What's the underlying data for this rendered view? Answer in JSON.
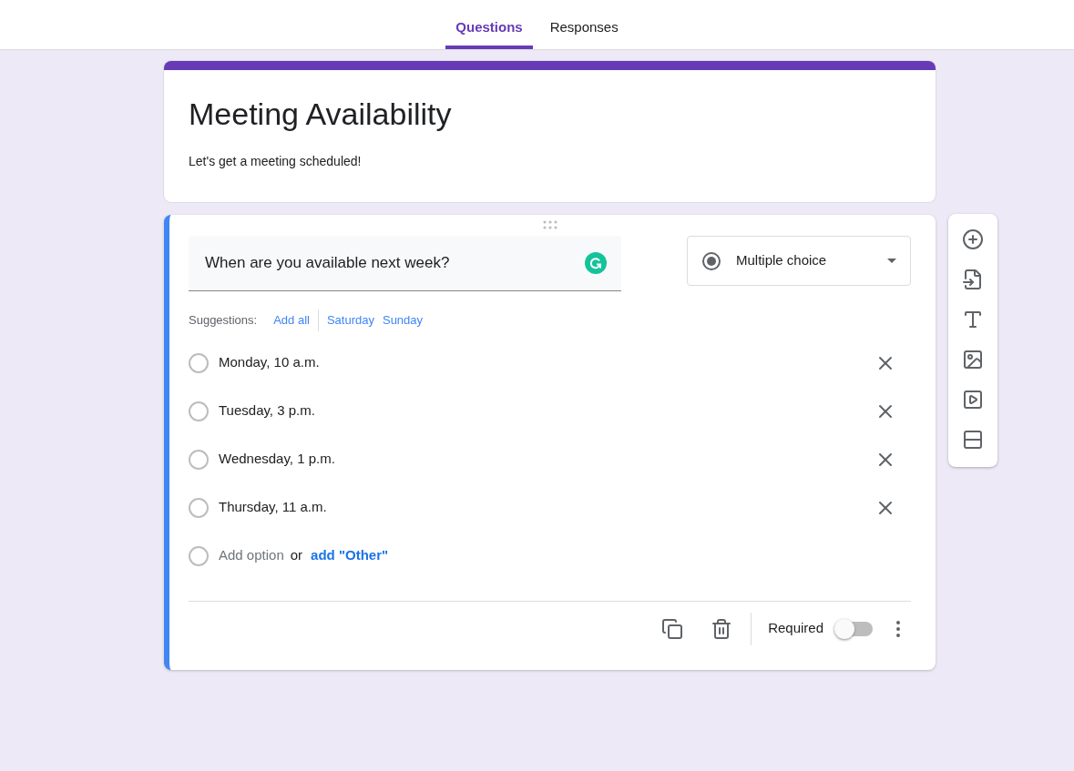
{
  "tabs": [
    {
      "label": "Questions",
      "selected": true
    },
    {
      "label": "Responses",
      "selected": false
    }
  ],
  "form": {
    "title": "Meeting Availability",
    "description": "Let's get a meeting scheduled!"
  },
  "question": {
    "text": "When are you available next week?",
    "type": "Multiple choice",
    "suggestions_label": "Suggestions:",
    "suggestions": [
      "Add all",
      "Saturday",
      "Sunday"
    ],
    "options": [
      {
        "label": "Monday, 10 a.m.",
        "selected": false
      },
      {
        "label": "Tuesday, 3 p.m.",
        "selected": false
      },
      {
        "label": "Wednesday, 1 p.m.",
        "selected": false
      },
      {
        "label": "Thursday, 11 a.m.",
        "selected": false
      }
    ],
    "add_option": "Add option",
    "add_option_selected": false,
    "or": "or",
    "add_other": "add \"Other\"",
    "required_label": "Required",
    "required": false
  }
}
